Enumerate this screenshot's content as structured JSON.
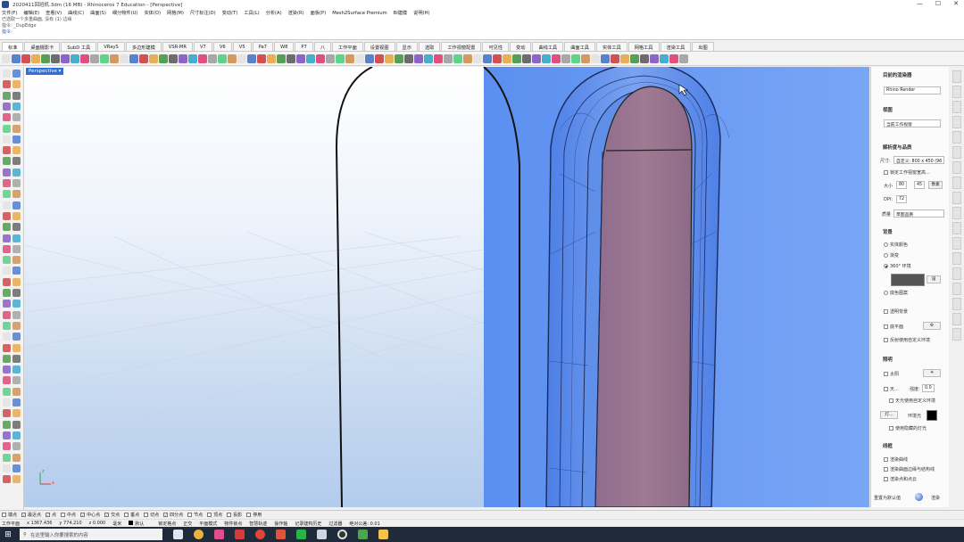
{
  "window": {
    "title": "2020411回班机.3dm (16 MB) - Rhinoceros 7 Education - [Perspective]",
    "min_label": "—",
    "max_label": "☐",
    "close_label": "✕"
  },
  "menu": [
    "文件(F)",
    "编辑(E)",
    "查看(V)",
    "曲线(C)",
    "曲面(S)",
    "细分物件(U)",
    "实体(O)",
    "网格(M)",
    "尺寸标注(D)",
    "变动(T)",
    "工具(L)",
    "分析(A)",
    "渲染(R)",
    "面板(P)",
    "Mesh2Surface Premium",
    "BI建模",
    "说明(H)"
  ],
  "command_history": [
    "已选取一个多重曲面, 没有 (1) 边缘",
    "指令: _DupEdge",
    "指令:"
  ],
  "tabs": [
    "标准",
    "桌面摄影卡",
    "SubD 工具",
    "VRayS",
    "多边形建模",
    "VSR-MR",
    "V7",
    "V6",
    "V5",
    "Pa7",
    "W8",
    "P7",
    "八",
    "工作平面",
    "设置视图",
    "显示",
    "选取",
    "工作视窗配置",
    "可见性",
    "变动",
    "曲线工具",
    "曲面工具",
    "实体工具",
    "网格工具",
    "渲染工具",
    "出图"
  ],
  "active_tab_index": 0,
  "viewport": {
    "label": "Perspective ▾",
    "axis_z": "z",
    "axis_x": "x"
  },
  "render_panel": {
    "section_current": "目前的渲染器",
    "renderer": "Rhino Render",
    "section_view": "视图",
    "view_value": "当前工作视窗",
    "section_resolution": "解析度与品质",
    "size_label": "尺寸:",
    "size_value": "自定义: 800 x 450 (96",
    "lock_viewport": "锁定工作视窗宽高...",
    "size_w_label": "大小",
    "size_w": "80",
    "size_h": "45",
    "units_btn": "像素",
    "dpi_label": "DPI:",
    "dpi_value": "72",
    "quality_label": "质量",
    "quality_value": "草图品质",
    "section_background": "背景",
    "bg_solid": "实体颜色",
    "bg_gradient": "渐变",
    "bg_360": "360° 环境",
    "bg_image": "底色图案",
    "env_dropdown": "设",
    "transparent_bg": "透明背景",
    "ground_plane": "底平面",
    "reflect_custom": "反射使用自定义环境",
    "section_lighting": "照明",
    "sun": "太阳",
    "sky": "天...",
    "skylight_intensity_label": "强度:",
    "skylight_intensity": "0.0",
    "sky_custom": "天光使用自定义环境",
    "lights_btn": "灯...",
    "env_color_label": "环境光",
    "use_hidden_lights": "使用隐藏的灯光",
    "section_linework": "线框",
    "render_curves": "渲染曲线",
    "render_edges": "渲染曲面边缘与结构线",
    "render_points": "渲染点和点云",
    "reset_btn": "重置为默认值",
    "render_btn": "渲染",
    "colors": {
      "lights_swatch": "#c0504d",
      "env_swatch": "#000000",
      "bg_swatch": "#555555"
    }
  },
  "osnaps": [
    {
      "label": "端点",
      "checked": false
    },
    {
      "label": "最近点",
      "checked": true
    },
    {
      "label": "点",
      "checked": true
    },
    {
      "label": "中点",
      "checked": false
    },
    {
      "label": "中心点",
      "checked": true
    },
    {
      "label": "交点",
      "checked": true
    },
    {
      "label": "垂点",
      "checked": false
    },
    {
      "label": "切点",
      "checked": false
    },
    {
      "label": "四分点",
      "checked": true
    },
    {
      "label": "节点",
      "checked": false
    },
    {
      "label": "顶点",
      "checked": false
    },
    {
      "label": "投影",
      "checked": false
    },
    {
      "label": "停用",
      "checked": false
    }
  ],
  "status": {
    "cplane": "工作平面",
    "x": "x 1367.436",
    "y": "y 774.210",
    "z": "z 0.000",
    "units": "毫米",
    "layer": "默认",
    "grid_snap": "锁定格点",
    "ortho": "正交",
    "planar": "平面模式",
    "osnap": "物件锁点",
    "smarttrack": "智慧轨迹",
    "gumball": "操作轴",
    "record_history": "记录建构历史",
    "filter": "过滤器",
    "cpu": "绝对公差: 0.01"
  },
  "taskbar": {
    "search_placeholder": "在这里输入你要搜索的内容"
  }
}
